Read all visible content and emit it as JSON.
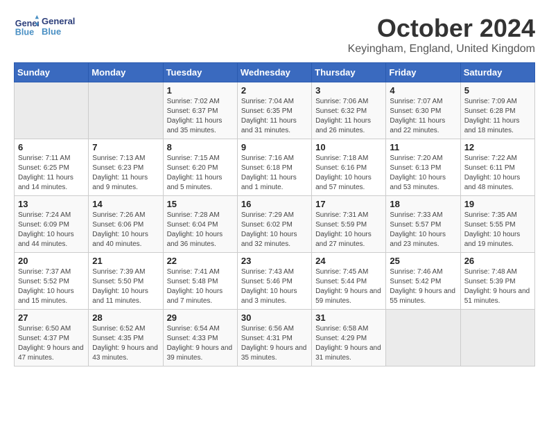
{
  "header": {
    "logo_line1": "General",
    "logo_line2": "Blue",
    "month_title": "October 2024",
    "subtitle": "Keyingham, England, United Kingdom"
  },
  "days_of_week": [
    "Sunday",
    "Monday",
    "Tuesday",
    "Wednesday",
    "Thursday",
    "Friday",
    "Saturday"
  ],
  "weeks": [
    [
      {
        "num": "",
        "detail": ""
      },
      {
        "num": "",
        "detail": ""
      },
      {
        "num": "1",
        "detail": "Sunrise: 7:02 AM\nSunset: 6:37 PM\nDaylight: 11 hours and 35 minutes."
      },
      {
        "num": "2",
        "detail": "Sunrise: 7:04 AM\nSunset: 6:35 PM\nDaylight: 11 hours and 31 minutes."
      },
      {
        "num": "3",
        "detail": "Sunrise: 7:06 AM\nSunset: 6:32 PM\nDaylight: 11 hours and 26 minutes."
      },
      {
        "num": "4",
        "detail": "Sunrise: 7:07 AM\nSunset: 6:30 PM\nDaylight: 11 hours and 22 minutes."
      },
      {
        "num": "5",
        "detail": "Sunrise: 7:09 AM\nSunset: 6:28 PM\nDaylight: 11 hours and 18 minutes."
      }
    ],
    [
      {
        "num": "6",
        "detail": "Sunrise: 7:11 AM\nSunset: 6:25 PM\nDaylight: 11 hours and 14 minutes."
      },
      {
        "num": "7",
        "detail": "Sunrise: 7:13 AM\nSunset: 6:23 PM\nDaylight: 11 hours and 9 minutes."
      },
      {
        "num": "8",
        "detail": "Sunrise: 7:15 AM\nSunset: 6:20 PM\nDaylight: 11 hours and 5 minutes."
      },
      {
        "num": "9",
        "detail": "Sunrise: 7:16 AM\nSunset: 6:18 PM\nDaylight: 11 hours and 1 minute."
      },
      {
        "num": "10",
        "detail": "Sunrise: 7:18 AM\nSunset: 6:16 PM\nDaylight: 10 hours and 57 minutes."
      },
      {
        "num": "11",
        "detail": "Sunrise: 7:20 AM\nSunset: 6:13 PM\nDaylight: 10 hours and 53 minutes."
      },
      {
        "num": "12",
        "detail": "Sunrise: 7:22 AM\nSunset: 6:11 PM\nDaylight: 10 hours and 48 minutes."
      }
    ],
    [
      {
        "num": "13",
        "detail": "Sunrise: 7:24 AM\nSunset: 6:09 PM\nDaylight: 10 hours and 44 minutes."
      },
      {
        "num": "14",
        "detail": "Sunrise: 7:26 AM\nSunset: 6:06 PM\nDaylight: 10 hours and 40 minutes."
      },
      {
        "num": "15",
        "detail": "Sunrise: 7:28 AM\nSunset: 6:04 PM\nDaylight: 10 hours and 36 minutes."
      },
      {
        "num": "16",
        "detail": "Sunrise: 7:29 AM\nSunset: 6:02 PM\nDaylight: 10 hours and 32 minutes."
      },
      {
        "num": "17",
        "detail": "Sunrise: 7:31 AM\nSunset: 5:59 PM\nDaylight: 10 hours and 27 minutes."
      },
      {
        "num": "18",
        "detail": "Sunrise: 7:33 AM\nSunset: 5:57 PM\nDaylight: 10 hours and 23 minutes."
      },
      {
        "num": "19",
        "detail": "Sunrise: 7:35 AM\nSunset: 5:55 PM\nDaylight: 10 hours and 19 minutes."
      }
    ],
    [
      {
        "num": "20",
        "detail": "Sunrise: 7:37 AM\nSunset: 5:52 PM\nDaylight: 10 hours and 15 minutes."
      },
      {
        "num": "21",
        "detail": "Sunrise: 7:39 AM\nSunset: 5:50 PM\nDaylight: 10 hours and 11 minutes."
      },
      {
        "num": "22",
        "detail": "Sunrise: 7:41 AM\nSunset: 5:48 PM\nDaylight: 10 hours and 7 minutes."
      },
      {
        "num": "23",
        "detail": "Sunrise: 7:43 AM\nSunset: 5:46 PM\nDaylight: 10 hours and 3 minutes."
      },
      {
        "num": "24",
        "detail": "Sunrise: 7:45 AM\nSunset: 5:44 PM\nDaylight: 9 hours and 59 minutes."
      },
      {
        "num": "25",
        "detail": "Sunrise: 7:46 AM\nSunset: 5:42 PM\nDaylight: 9 hours and 55 minutes."
      },
      {
        "num": "26",
        "detail": "Sunrise: 7:48 AM\nSunset: 5:39 PM\nDaylight: 9 hours and 51 minutes."
      }
    ],
    [
      {
        "num": "27",
        "detail": "Sunrise: 6:50 AM\nSunset: 4:37 PM\nDaylight: 9 hours and 47 minutes."
      },
      {
        "num": "28",
        "detail": "Sunrise: 6:52 AM\nSunset: 4:35 PM\nDaylight: 9 hours and 43 minutes."
      },
      {
        "num": "29",
        "detail": "Sunrise: 6:54 AM\nSunset: 4:33 PM\nDaylight: 9 hours and 39 minutes."
      },
      {
        "num": "30",
        "detail": "Sunrise: 6:56 AM\nSunset: 4:31 PM\nDaylight: 9 hours and 35 minutes."
      },
      {
        "num": "31",
        "detail": "Sunrise: 6:58 AM\nSunset: 4:29 PM\nDaylight: 9 hours and 31 minutes."
      },
      {
        "num": "",
        "detail": ""
      },
      {
        "num": "",
        "detail": ""
      }
    ]
  ]
}
